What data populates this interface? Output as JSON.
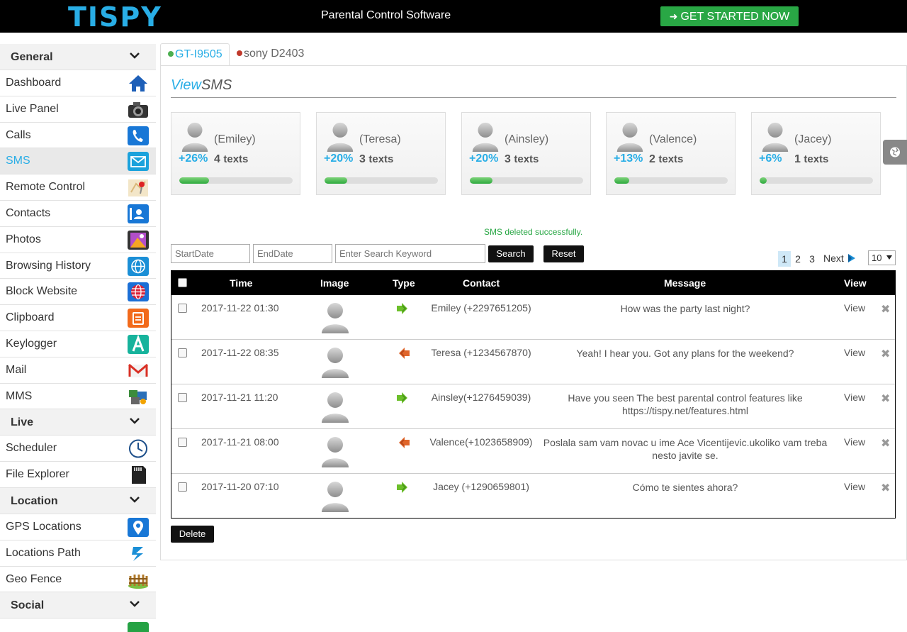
{
  "header": {
    "logo": "TISPY",
    "title": "Parental Control Software",
    "cta_label": "GET STARTED NOW",
    "cta_color": "#29a745"
  },
  "sidebar": {
    "groups": {
      "general": "General",
      "live": "Live",
      "location": "Location",
      "social": "Social"
    },
    "items": {
      "dashboard": "Dashboard",
      "live_panel": "Live Panel",
      "calls": "Calls",
      "sms": "SMS",
      "remote_control": "Remote Control",
      "contacts": "Contacts",
      "photos": "Photos",
      "browsing_history": "Browsing History",
      "block_website": "Block Website",
      "clipboard": "Clipboard",
      "keylogger": "Keylogger",
      "mail": "Mail",
      "mms": "MMS",
      "scheduler": "Scheduler",
      "file_explorer": "File Explorer",
      "gps_locations": "GPS Locations",
      "locations_path": "Locations Path",
      "geo_fence": "Geo Fence"
    },
    "active": "SMS"
  },
  "devices": {
    "tab1": "GT-I9505",
    "tab2": "sony D2403"
  },
  "view": {
    "title_prefix": "View",
    "title_suffix": "SMS"
  },
  "cards": [
    {
      "name": "(Emiley)",
      "pct": "+26%",
      "count": "4",
      "unit": "texts",
      "level": 0.26
    },
    {
      "name": "(Teresa)",
      "pct": "+20%",
      "count": "3",
      "unit": "texts",
      "level": 0.2
    },
    {
      "name": "(Ainsley)",
      "pct": "+20%",
      "count": "3",
      "unit": "texts",
      "level": 0.2
    },
    {
      "name": "(Valence)",
      "pct": "+13%",
      "count": "2",
      "unit": "texts",
      "level": 0.13
    },
    {
      "name": "(Jacey)",
      "pct": "+6%",
      "count": "1",
      "unit": "texts",
      "level": 0.06
    }
  ],
  "status_message": "SMS deleted successfully.",
  "filters": {
    "start_placeholder": "StartDate",
    "end_placeholder": "EndDate",
    "keyword_placeholder": "Enter Search Keyword",
    "search_label": "Search",
    "reset_label": "Reset"
  },
  "pagination": {
    "pages": [
      "1",
      "2",
      "3"
    ],
    "current": "1",
    "next_label": "Next",
    "page_size": "10"
  },
  "table": {
    "headers": {
      "time": "Time",
      "image": "Image",
      "type": "Type",
      "contact": "Contact",
      "message": "Message",
      "view": "View"
    },
    "rows": [
      {
        "time": "2017-11-22 01:30",
        "direction": "outgoing",
        "contact": "Emiley (+2297651205)",
        "message": "How was the party last night?",
        "view": "View"
      },
      {
        "time": "2017-11-22 08:35",
        "direction": "incoming",
        "contact": "Teresa (+1234567870)",
        "message": "Yeah! I hear you. Got any plans for the weekend?",
        "view": "View"
      },
      {
        "time": "2017-11-21 11:20",
        "direction": "outgoing",
        "contact": "Ainsley(+1276459039)",
        "message": "Have you seen The best parental control features like https://tispy.net/features.html",
        "view": "View"
      },
      {
        "time": "2017-11-21 08:00",
        "direction": "incoming",
        "contact": "Valence(+1023658909)",
        "message": "Poslala sam vam novac u ime Ace Vicentijevic.ukoliko vam treba nesto javite se.",
        "view": "View"
      },
      {
        "time": "2017-11-20 07:10",
        "direction": "outgoing",
        "contact": "Jacey (+1290659801)",
        "message": "Cómo te sientes ahora?",
        "view": "View"
      }
    ]
  },
  "delete_label": "Delete",
  "colors": {
    "accent": "#29aee6",
    "outgoing_arrow": "#6cbf2a",
    "incoming_arrow": "#e0652a"
  }
}
